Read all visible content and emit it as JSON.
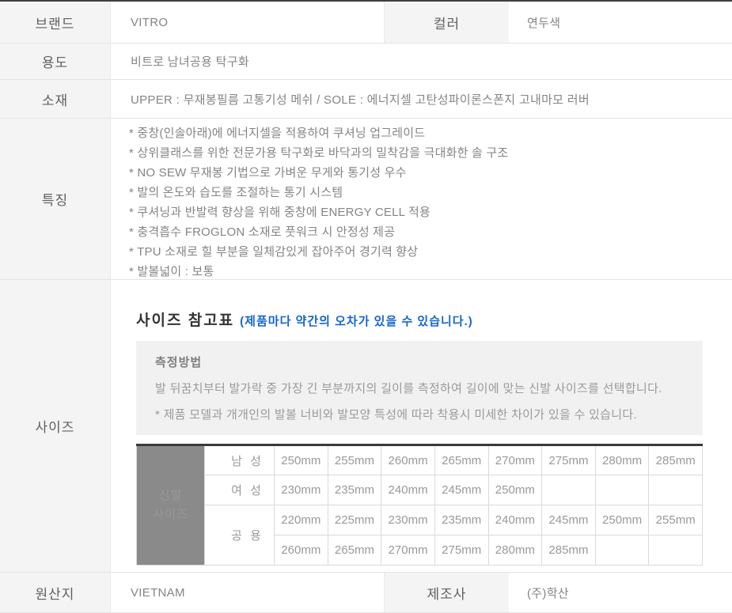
{
  "colors": {
    "accent_blue": "#1565d0",
    "size_header_bg": "#8a8a8a",
    "label_bg": "#f4f4f4",
    "top_border": "#3f3f3f"
  },
  "spec": {
    "brand": {
      "label": "브랜드",
      "value": "VITRO"
    },
    "color": {
      "label": "컬러",
      "value": "연두색"
    },
    "usage": {
      "label": "용도",
      "value": "비트로 남녀공용 탁구화"
    },
    "material": {
      "label": "소재",
      "value": "UPPER : 무재봉필름 고통기성 메쉬 / SOLE : 에너지셀 고탄성파이론스폰지 고내마모 러버"
    },
    "features": {
      "label": "특징",
      "items": [
        "* 중창(인솔아래)에 에너지셀을 적용하여 쿠셔닝 업그레이드",
        "* 상위클래스를 위한 전문가용 탁구화로 바닥과의 밀착감을 극대화한 솔 구조",
        "* NO SEW 무재봉 기법으로 가벼운 무게와 통기성 우수",
        "* 발의 온도와 습도를 조절하는 통기 시스템",
        "* 쿠셔닝과 반발력 향상을 위해 중창에 ENERGY CELL 적용",
        "* 충격흡수 FROGLON 소재로 풋워크 시 안정성 제공",
        "* TPU 소재로 힐 부분을 일체감있게 잡아주어 경기력 향상",
        "* 발볼넓이 : 보통"
      ]
    },
    "size_label": "사이즈",
    "origin": {
      "label": "원산지",
      "value": "VIETNAM"
    },
    "manufacturer": {
      "label": "제조사",
      "value": "(주)학산"
    }
  },
  "size": {
    "title": "사이즈 참고표",
    "note": "(제품마다 약간의 오차가 있을 수 있습니다.)",
    "measure": {
      "heading": "측정방법",
      "line1": "발 뒤꿈치부터 발가락 중 가장 긴 부분까지의 길이를 측정하여 길이에 맞는 신발 사이즈를 선택합니다.",
      "line2": "* 제품 모델과 개개인의 발볼 너비와 발모양 특성에 따라 착용시 미세한 차이가 있을 수 있습니다."
    },
    "table": {
      "corner_line1": "신발",
      "corner_line2": "사이즈",
      "rows": [
        {
          "category": "남 성",
          "values": [
            "250mm",
            "255mm",
            "260mm",
            "265mm",
            "270mm",
            "275mm",
            "280mm",
            "285mm"
          ]
        },
        {
          "category": "여 성",
          "values": [
            "230mm",
            "235mm",
            "240mm",
            "245mm",
            "250mm",
            "",
            "",
            ""
          ]
        },
        {
          "category": "공 용",
          "values": [
            "220mm",
            "225mm",
            "230mm",
            "235mm",
            "240mm",
            "245mm",
            "250mm",
            "255mm"
          ]
        },
        {
          "category": "",
          "values": [
            "260mm",
            "265mm",
            "270mm",
            "275mm",
            "280mm",
            "285mm",
            "",
            ""
          ]
        }
      ]
    }
  }
}
